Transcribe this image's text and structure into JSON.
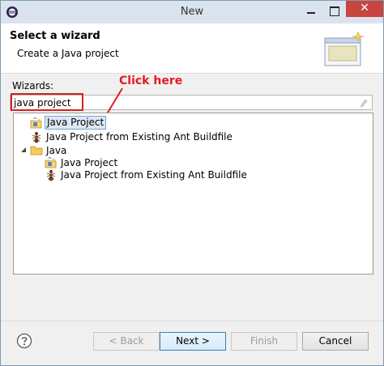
{
  "window": {
    "title": "New",
    "close_glyph": "✕"
  },
  "header": {
    "title": "Select a wizard",
    "subtitle": "Create a Java project"
  },
  "wizards": {
    "label": "Wizards:",
    "filter_value": "java project"
  },
  "annotation": {
    "text": "Click here",
    "color": "#e31b23"
  },
  "tree": {
    "items": [
      {
        "label": "Java Project",
        "icon": "java-project-icon",
        "selected": true
      },
      {
        "label": "Java Project from Existing Ant Buildfile",
        "icon": "ant-icon"
      },
      {
        "label": "Java",
        "icon": "folder-icon",
        "expanded": true
      },
      {
        "label": "Java Project",
        "icon": "java-project-icon"
      },
      {
        "label": "Java Project from Existing Ant Buildfile",
        "icon": "ant-icon"
      }
    ]
  },
  "buttons": {
    "back": "< Back",
    "next": "Next >",
    "finish": "Finish",
    "cancel": "Cancel"
  }
}
